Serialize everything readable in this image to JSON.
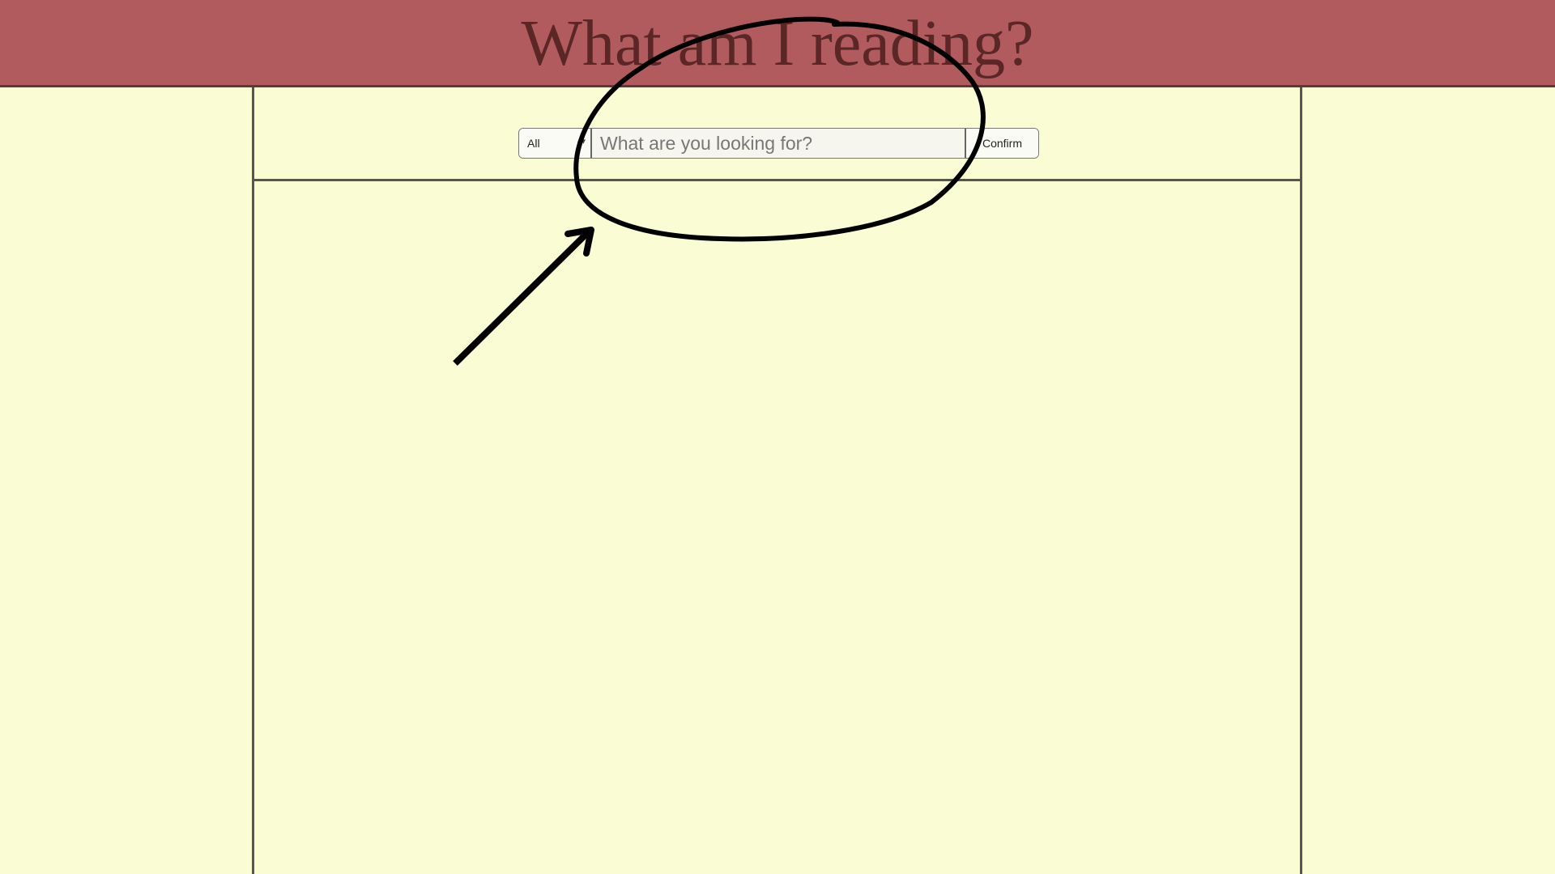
{
  "header": {
    "title": "What am I reading?",
    "background_color": "#b15b5f",
    "title_color": "#5a2626"
  },
  "search": {
    "category_label": "All",
    "category_icon": "chevron-down-icon",
    "placeholder": "What are you looking for?",
    "value": "",
    "confirm_label": "Confirm"
  },
  "theme": {
    "page_background": "#fafdd4",
    "border_color": "#555555"
  },
  "annotation": {
    "shapes": [
      "hand-drawn-ellipse",
      "arrow"
    ],
    "stroke_color": "#000000"
  }
}
